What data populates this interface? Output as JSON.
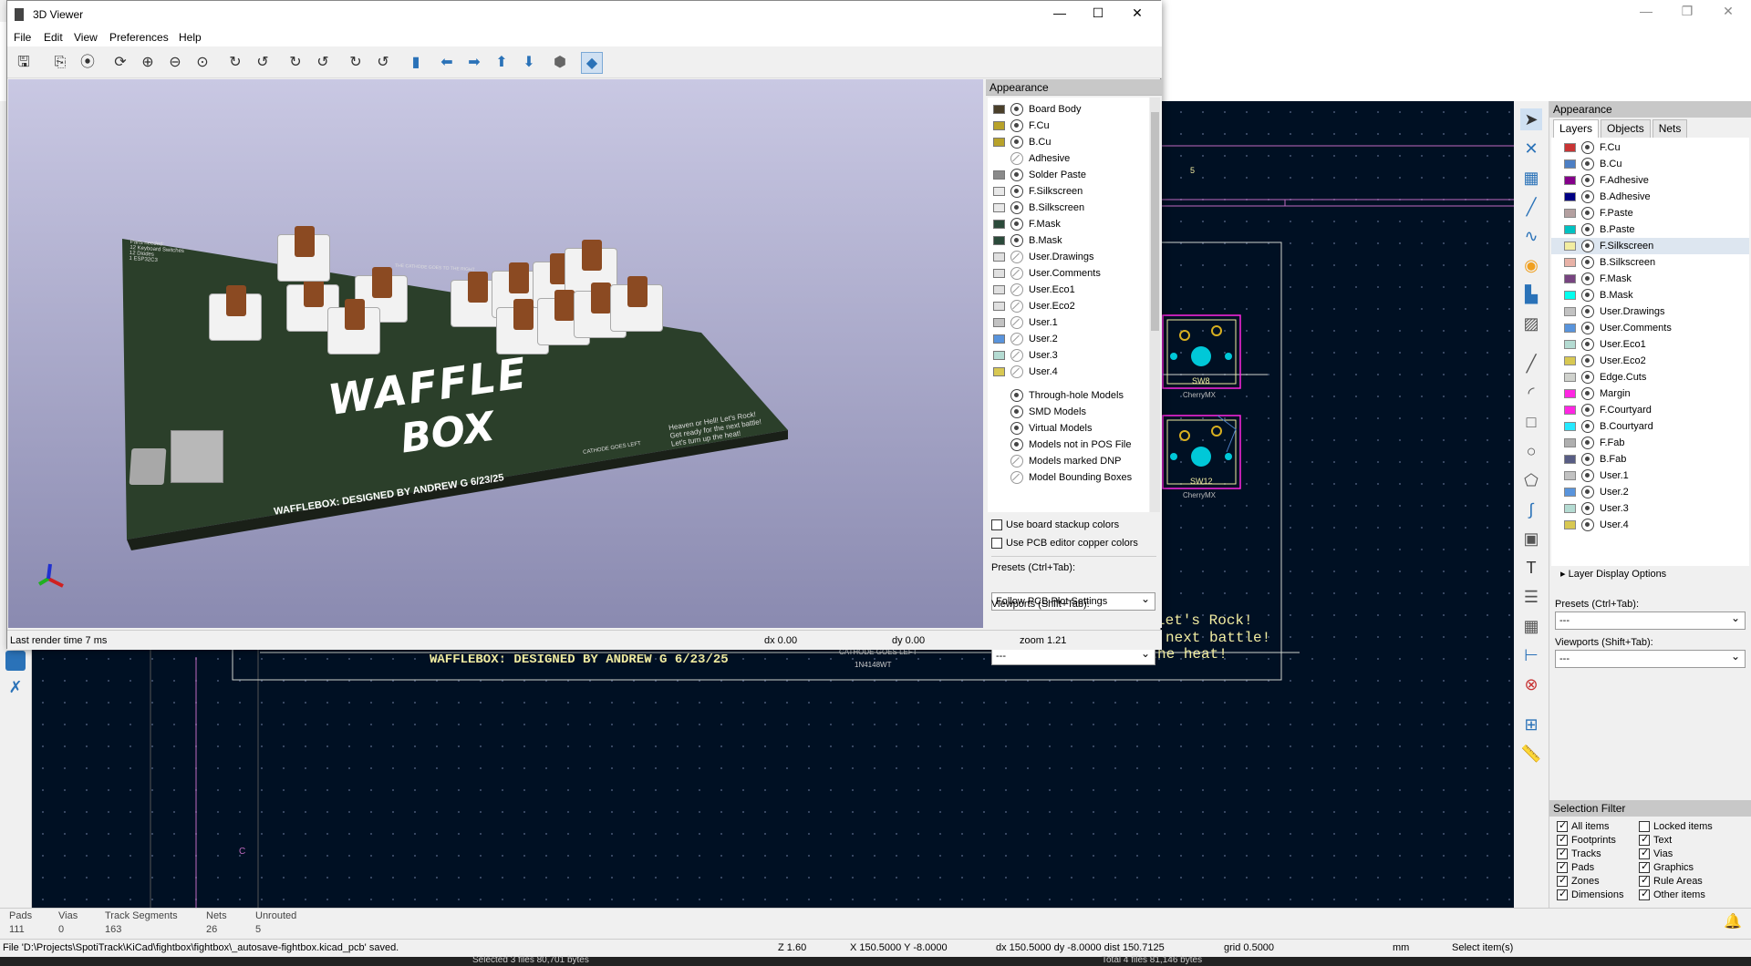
{
  "pcb_window": {
    "controls": [
      "—",
      "❐",
      "✕"
    ]
  },
  "pcb_canvas": {
    "silk_credit": "WAFFLEBOX: DESIGNED BY ANDREW G 6/23/25",
    "silk_msg_1": "Let's Rock!",
    "silk_msg_2": "next battle!",
    "silk_msg_3": "Let's turn up the heat!",
    "cathode": "CATHODE GOES LEFT",
    "diode": "1N4148WT",
    "sw8": "SW8",
    "sw12": "SW12",
    "cherry": "CherryMX",
    "five": "5",
    "c_label": "C"
  },
  "appearance": {
    "title": "Appearance",
    "tabs": [
      "Layers",
      "Objects",
      "Nets"
    ],
    "layers": [
      {
        "name": "F.Cu",
        "color": "#c83434"
      },
      {
        "name": "B.Cu",
        "color": "#4d7fc4"
      },
      {
        "name": "F.Adhesive",
        "color": "#84008a"
      },
      {
        "name": "B.Adhesive",
        "color": "#000084"
      },
      {
        "name": "F.Paste",
        "color": "#b4a0a0"
      },
      {
        "name": "B.Paste",
        "color": "#00c2c2"
      },
      {
        "name": "F.Silkscreen",
        "color": "#f2eda1"
      },
      {
        "name": "B.Silkscreen",
        "color": "#e8b2a7"
      },
      {
        "name": "F.Mask",
        "color": "#774480"
      },
      {
        "name": "B.Mask",
        "color": "#02ffee"
      },
      {
        "name": "User.Drawings",
        "color": "#c2c2c2"
      },
      {
        "name": "User.Comments",
        "color": "#5994dc"
      },
      {
        "name": "User.Eco1",
        "color": "#b4dbd2"
      },
      {
        "name": "User.Eco2",
        "color": "#d8c852"
      },
      {
        "name": "Edge.Cuts",
        "color": "#d0d2cd"
      },
      {
        "name": "Margin",
        "color": "#ff26e2"
      },
      {
        "name": "F.Courtyard",
        "color": "#ff26e2"
      },
      {
        "name": "B.Courtyard",
        "color": "#26e9ff"
      },
      {
        "name": "F.Fab",
        "color": "#afafaf"
      },
      {
        "name": "B.Fab",
        "color": "#585d84"
      },
      {
        "name": "User.1",
        "color": "#c2c2c2"
      },
      {
        "name": "User.2",
        "color": "#5994dc"
      },
      {
        "name": "User.3",
        "color": "#b4dbd2"
      },
      {
        "name": "User.4",
        "color": "#d8c852"
      }
    ],
    "layer_display_options": "Layer Display Options",
    "presets_label": "Presets (Ctrl+Tab):",
    "presets_value": "---",
    "viewports_label": "Viewports (Shift+Tab):",
    "viewports_value": "---"
  },
  "selection_filter": {
    "title": "Selection Filter",
    "items": [
      {
        "label": "All items",
        "checked": true
      },
      {
        "label": "Locked items",
        "checked": false
      },
      {
        "label": "Footprints",
        "checked": true
      },
      {
        "label": "Text",
        "checked": true
      },
      {
        "label": "Tracks",
        "checked": true
      },
      {
        "label": "Vias",
        "checked": true
      },
      {
        "label": "Pads",
        "checked": true
      },
      {
        "label": "Graphics",
        "checked": true
      },
      {
        "label": "Zones",
        "checked": true
      },
      {
        "label": "Rule Areas",
        "checked": true
      },
      {
        "label": "Dimensions",
        "checked": true
      },
      {
        "label": "Other items",
        "checked": true
      }
    ]
  },
  "msg_panel": {
    "headers": [
      "Pads",
      "Vias",
      "Track Segments",
      "Nets",
      "Unrouted"
    ],
    "values": [
      "111",
      "0",
      "163",
      "26",
      "5"
    ]
  },
  "statusbar": {
    "file_msg": "File 'D:\\Projects\\SpotiTrack\\KiCad\\fightbox\\fightbox\\_autosave-fightbox.kicad_pcb' saved.",
    "z": "Z 1.60",
    "xy": "X 150.5000  Y -8.0000",
    "delta": "dx 150.5000  dy -8.0000  dist 150.7125",
    "grid": "grid 0.5000",
    "units": "mm",
    "mode": "Select item(s)"
  },
  "taskbar": {
    "left": "Selected 3 files  80,701 bytes",
    "right": "Total 4 files  81,146 bytes"
  },
  "viewer": {
    "title": "3D Viewer",
    "controls": [
      "—",
      "☐",
      "✕"
    ],
    "menu": [
      "File",
      "Edit",
      "View",
      "Preferences",
      "Help"
    ],
    "appearance_title": "Appearance",
    "layers": [
      {
        "name": "Board Body",
        "color": "#4a3f2a",
        "eye": true
      },
      {
        "name": "F.Cu",
        "color": "#b8a22a",
        "eye": true
      },
      {
        "name": "B.Cu",
        "color": "#b8a22a",
        "eye": true
      },
      {
        "name": "Adhesive",
        "color": "",
        "eye": false
      },
      {
        "name": "Solder Paste",
        "color": "#8a8a8a",
        "eye": true
      },
      {
        "name": "F.Silkscreen",
        "color": "#e8e8e8",
        "eye": true
      },
      {
        "name": "B.Silkscreen",
        "color": "#e8e8e8",
        "eye": true
      },
      {
        "name": "F.Mask",
        "color": "#2b4a3a",
        "eye": true
      },
      {
        "name": "B.Mask",
        "color": "#2b4a3a",
        "eye": true
      },
      {
        "name": "User.Drawings",
        "color": "#e0e0e0",
        "eye": false
      },
      {
        "name": "User.Comments",
        "color": "#e0e0e0",
        "eye": false
      },
      {
        "name": "User.Eco1",
        "color": "#e0e0e0",
        "eye": false
      },
      {
        "name": "User.Eco2",
        "color": "#e0e0e0",
        "eye": false
      },
      {
        "name": "User.1",
        "color": "#c2c2c2",
        "eye": false
      },
      {
        "name": "User.2",
        "color": "#5994dc",
        "eye": false
      },
      {
        "name": "User.3",
        "color": "#b4dbd2",
        "eye": false
      },
      {
        "name": "User.4",
        "color": "#d8c852",
        "eye": false
      }
    ],
    "models": [
      {
        "name": "Through-hole Models",
        "eye": true
      },
      {
        "name": "SMD Models",
        "eye": true
      },
      {
        "name": "Virtual Models",
        "eye": true
      },
      {
        "name": "Models not in POS File",
        "eye": true
      },
      {
        "name": "Models marked DNP",
        "eye": false
      },
      {
        "name": "Model Bounding Boxes",
        "eye": false
      }
    ],
    "opt_stackup": "Use board stackup colors",
    "opt_copper": "Use PCB editor copper colors",
    "presets_label": "Presets (Ctrl+Tab):",
    "presets_value": "Follow PCB Plot Settings",
    "viewports_label": "Viewports (Shift+Tab):",
    "viewports_value": "---",
    "status_render": "Last render time 7 ms",
    "status_dx": "dx 0.00",
    "status_dy": "dy 0.00",
    "status_zoom": "zoom 1.21",
    "board_text": {
      "waffle": "WAFFLE",
      "box": "BOX",
      "credit": "WAFFLEBOX: DESIGNED BY ANDREW G 6/23/25",
      "parts": "Parts needed:\n12 Keyboard Switches\n12 Diodes\n1 ESP32C3",
      "heat": "Heaven or Hell! Let's Rock!\nGet ready for the next battle!\nLet's turn up the heat!",
      "cathode": "CATHODE GOES LEFT",
      "cathode_top": "THE CATHODE GOES TO THE RIGHT"
    }
  }
}
